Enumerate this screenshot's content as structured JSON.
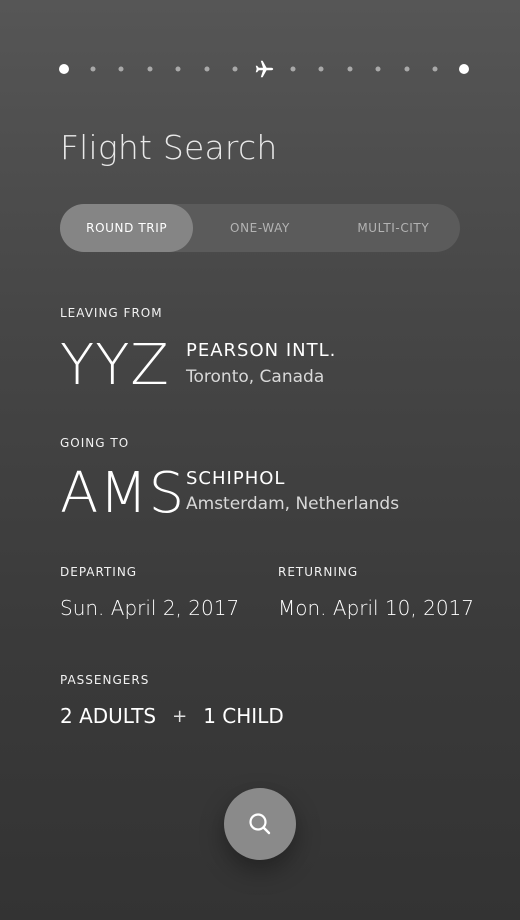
{
  "title": "Flight Search",
  "trip_types": [
    {
      "label": "ROUND TRIP",
      "active": true
    },
    {
      "label": "ONE-WAY",
      "active": false
    },
    {
      "label": "MULTI-CITY",
      "active": false
    }
  ],
  "progress": {
    "icon": "airplane-icon",
    "stop_count": 15,
    "current_index": 7
  },
  "origin": {
    "label": "LEAVING FROM",
    "code": "YYZ",
    "name": "PEARSON INTL.",
    "city": "Toronto, Canada"
  },
  "destination": {
    "label": "GOING TO",
    "code": "AMS",
    "name": "SCHIPHOL",
    "city": "Amsterdam, Netherlands"
  },
  "departing": {
    "label": "DEPARTING",
    "value": "Sun. April 2, 2017"
  },
  "returning": {
    "label": "RETURNING",
    "value": "Mon. April 10, 2017"
  },
  "passengers": {
    "label": "PASSENGERS",
    "adults": "2 ADULTS",
    "separator": "+",
    "children": "1 CHILD"
  },
  "search_button": {
    "icon": "search-icon"
  },
  "colors": {
    "background_top": "#565656",
    "background_bottom": "#333333",
    "segment_track": "#5b5b5b",
    "segment_active": "#858585",
    "search_button": "#8a8a8a"
  }
}
